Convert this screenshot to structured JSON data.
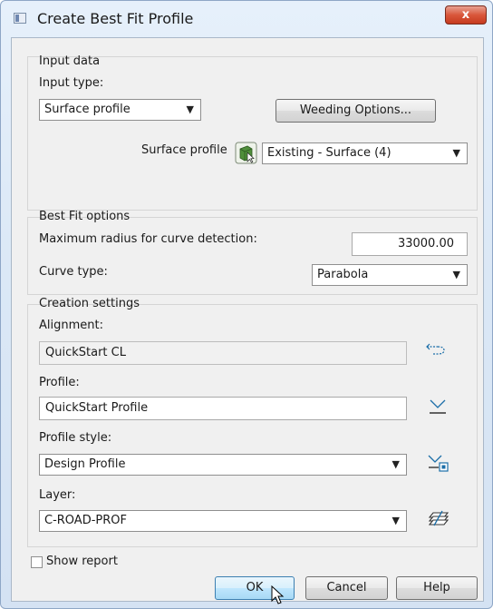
{
  "window": {
    "title": "Create Best Fit Profile",
    "close_glyph": "x"
  },
  "input_data": {
    "group_label": "Input data",
    "input_type_label": "Input type:",
    "input_type_value": "Surface profile",
    "weeding_button": "Weeding Options...",
    "surface_profile_label": "Surface profile",
    "surface_profile_value": "Existing - Surface (4)"
  },
  "best_fit": {
    "group_label": "Best Fit options",
    "max_radius_label": "Maximum radius for curve detection:",
    "max_radius_value": "33000.00",
    "curve_type_label": "Curve type:",
    "curve_type_value": "Parabola"
  },
  "creation": {
    "group_label": "Creation settings",
    "alignment_label": "Alignment:",
    "alignment_value": "QuickStart CL",
    "profile_label": "Profile:",
    "profile_value": "QuickStart Profile",
    "profile_style_label": "Profile style:",
    "profile_style_value": "Design Profile",
    "layer_label": "Layer:",
    "layer_value": "C-ROAD-PROF"
  },
  "show_report": {
    "label": "Show report",
    "checked": false
  },
  "buttons": {
    "ok": "OK",
    "cancel": "Cancel",
    "help": "Help"
  },
  "icons": {
    "surface_pick": "surface-pick-icon",
    "alignment_pick": "alignment-pick-icon",
    "profile_edit": "profile-edit-icon",
    "profile_style_edit": "profile-style-edit-icon",
    "layer_edit": "layer-icon"
  },
  "colors": {
    "accent": "#3c7fb1",
    "close_button": "#c63b1f",
    "frame": "#dbe8f6"
  }
}
